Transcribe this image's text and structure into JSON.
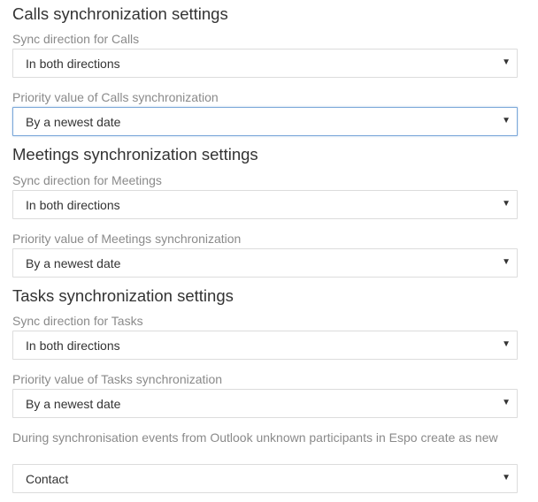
{
  "calls": {
    "title": "Calls synchronization settings",
    "direction_label": "Sync direction for Calls",
    "direction_value": "In both directions",
    "priority_label": "Priority value of Calls synchronization",
    "priority_value": "By a newest date"
  },
  "meetings": {
    "title": "Meetings synchronization settings",
    "direction_label": "Sync direction for Meetings",
    "direction_value": "In both directions",
    "priority_label": "Priority value of Meetings synchronization",
    "priority_value": "By a newest date"
  },
  "tasks": {
    "title": "Tasks synchronization settings",
    "direction_label": "Sync direction for Tasks",
    "direction_value": "In both directions",
    "priority_label": "Priority value of Tasks synchronization",
    "priority_value": "By a newest date"
  },
  "participants": {
    "label": "During synchronisation events from Outlook unknown participants in Espo create as new",
    "value": "Contact"
  },
  "icons": {
    "dropdown_arrow": "▼"
  }
}
